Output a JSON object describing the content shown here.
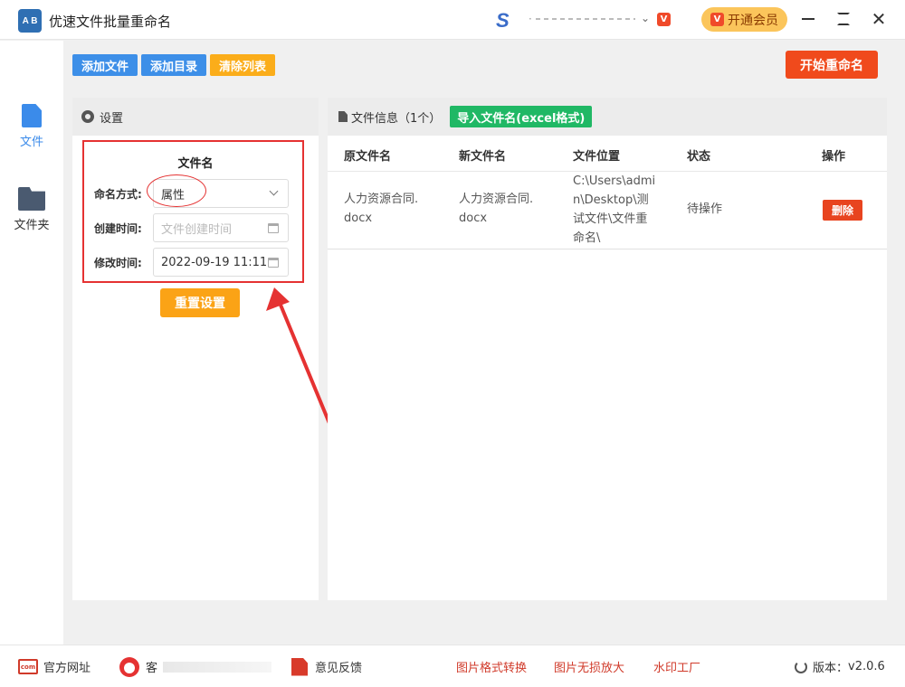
{
  "app": {
    "title": "优速文件批量重命名",
    "logo_text": "A B"
  },
  "titlebar": {
    "user_logo": "S",
    "user_name": "·",
    "vip_badge": "V",
    "open_vip": "开通会员",
    "open_vip_icon": "V"
  },
  "sidebar": {
    "items": [
      {
        "label": "文件",
        "icon": "file-icon",
        "active_color": "#3b8bea"
      },
      {
        "label": "文件夹",
        "icon": "folder-icon"
      }
    ]
  },
  "toolbar": {
    "add_file": "添加文件",
    "add_dir": "添加目录",
    "clear_list": "清除列表",
    "start_rename": "开始重命名"
  },
  "settings": {
    "header": "设置",
    "section_title": "文件名",
    "mode_label": "命名方式:",
    "mode_value": "属性",
    "ctime_label": "创建时间:",
    "ctime_placeholder": "文件创建时间",
    "mtime_label": "修改时间:",
    "mtime_value": "2022-09-19 11:11",
    "reset": "重置设置"
  },
  "file_info": {
    "header": "文件信息（1个）",
    "import_button": "导入文件名(excel格式)",
    "columns": [
      "原文件名",
      "新文件名",
      "文件位置",
      "状态",
      "操作"
    ],
    "rows": [
      {
        "original": [
          "人力资源合同.",
          "docx"
        ],
        "new": [
          "人力资源合同.",
          "docx"
        ],
        "location": [
          "C:\\Users\\admi",
          "n\\Desktop\\测",
          "试文件\\文件重",
          "命名\\"
        ],
        "status": "待操作",
        "action": "删除"
      }
    ]
  },
  "footer": {
    "site": "官方网址",
    "site_icon_text": "com",
    "service": "客",
    "feedback": "意见反馈",
    "convert": "图片格式转换",
    "enlarge": "图片无损放大",
    "watermark": "水印工厂",
    "version_label": "版本：",
    "version": "v2.0.6"
  },
  "colors": {
    "primary_blue": "#3d8fe8",
    "orange": "#fbad1a",
    "red": "#f04a1c",
    "green": "#20b865",
    "annotation_red": "#e53232"
  }
}
